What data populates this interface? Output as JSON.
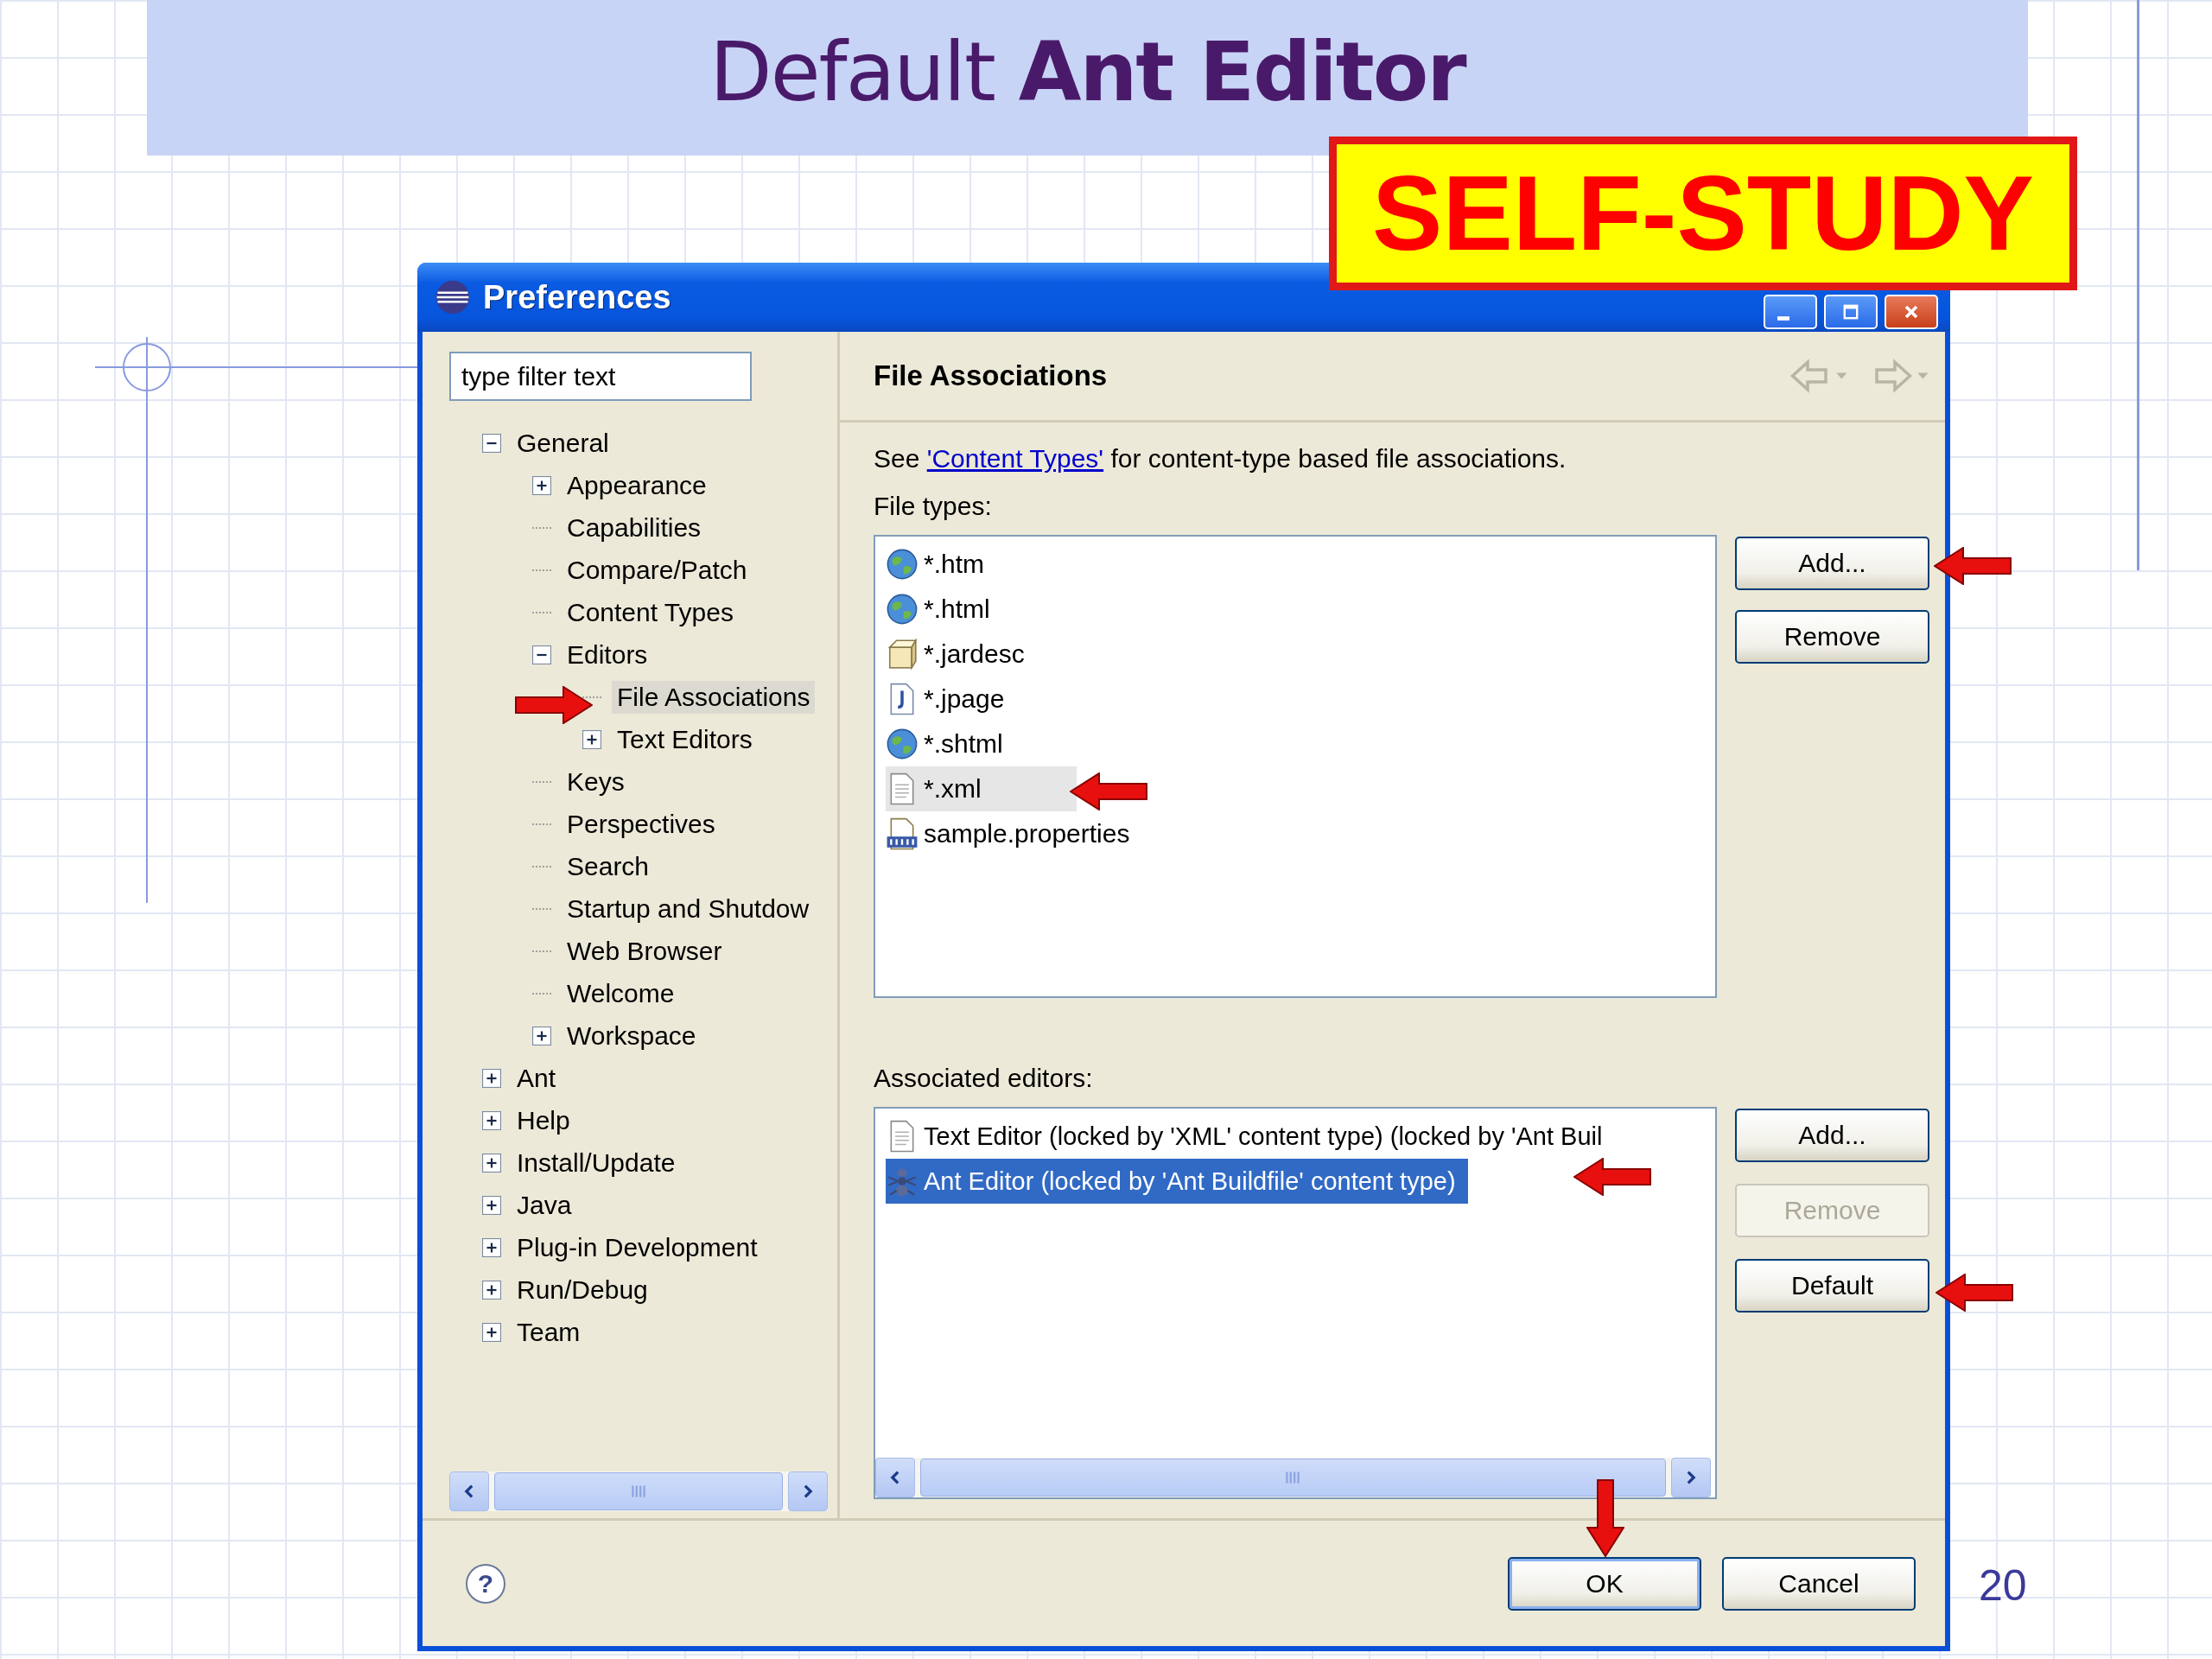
{
  "slide": {
    "title": "Default **Ant Editor**",
    "badge": "SELF-STUDY",
    "page_number": "20"
  },
  "window": {
    "title": "Preferences"
  },
  "filter": {
    "value": "type filter text"
  },
  "tree": [
    {
      "label": "General",
      "expanded": true,
      "selected": false,
      "children": [
        {
          "label": "Appearance",
          "expanded": false,
          "selected": false
        },
        {
          "label": "Capabilities",
          "selected": false
        },
        {
          "label": "Compare/Patch",
          "selected": false
        },
        {
          "label": "Content Types",
          "selected": false
        },
        {
          "label": "Editors",
          "expanded": true,
          "selected": false,
          "children": [
            {
              "label": "File Associations",
              "selected": true
            },
            {
              "label": "Text Editors",
              "expanded": false,
              "selected": false
            }
          ]
        },
        {
          "label": "Keys",
          "selected": false
        },
        {
          "label": "Perspectives",
          "selected": false
        },
        {
          "label": "Search",
          "selected": false
        },
        {
          "label": "Startup and Shutdow",
          "selected": false
        },
        {
          "label": "Web Browser",
          "selected": false
        },
        {
          "label": "Welcome",
          "selected": false
        },
        {
          "label": "Workspace",
          "expanded": false,
          "selected": false
        }
      ]
    },
    {
      "label": "Ant",
      "expanded": false,
      "selected": false
    },
    {
      "label": "Help",
      "expanded": false,
      "selected": false
    },
    {
      "label": "Install/Update",
      "expanded": false,
      "selected": false
    },
    {
      "label": "Java",
      "expanded": false,
      "selected": false
    },
    {
      "label": "Plug-in Development",
      "expanded": false,
      "selected": false
    },
    {
      "label": "Run/Debug",
      "expanded": false,
      "selected": false
    },
    {
      "label": "Team",
      "expanded": false,
      "selected": false
    }
  ],
  "page": {
    "title": "File Associations",
    "nav_buttons": [
      {
        "kind": "back",
        "disabled": true
      },
      {
        "kind": "forward",
        "disabled": true
      }
    ],
    "description": {
      "before": "See ",
      "link": "'Content Types'",
      "after": " for content-type based file associations."
    }
  },
  "file_types": {
    "label": "File types:",
    "focused": false,
    "items": [
      {
        "name": "*.htm",
        "kind": "web",
        "selected": false
      },
      {
        "name": "*.html",
        "kind": "web",
        "selected": false
      },
      {
        "name": "*.jardesc",
        "kind": "jar",
        "selected": false
      },
      {
        "name": "*.jpage",
        "kind": "java",
        "selected": false
      },
      {
        "name": "*.shtml",
        "kind": "web",
        "selected": false
      },
      {
        "name": "*.xml",
        "kind": "text",
        "selected": true
      },
      {
        "name": "sample.properties",
        "kind": "properties",
        "selected": false
      }
    ],
    "buttons": [
      {
        "label": "Add...",
        "disabled": false
      },
      {
        "label": "Remove",
        "disabled": false
      }
    ]
  },
  "editors": {
    "label": "Associated editors:",
    "focused": true,
    "items": [
      {
        "name": "Text Editor (locked by 'XML' content type) (locked by 'Ant Buil",
        "kind": "text",
        "selected": false
      },
      {
        "name": "Ant Editor (locked by 'Ant Buildfile' content type)",
        "kind": "ant",
        "selected": true
      }
    ],
    "buttons": [
      {
        "label": "Add...",
        "disabled": false
      },
      {
        "label": "Remove",
        "disabled": true
      },
      {
        "label": "Default",
        "disabled": false
      }
    ]
  },
  "footer": {
    "help": "?",
    "buttons": [
      {
        "label": "OK",
        "default": true
      },
      {
        "label": "Cancel",
        "default": false
      }
    ]
  }
}
